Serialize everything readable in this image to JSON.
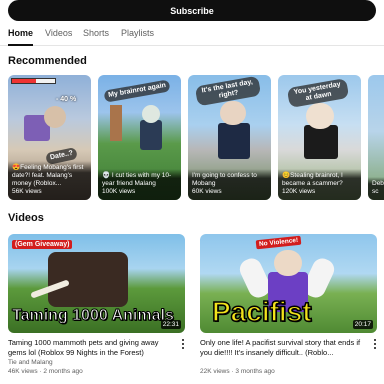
{
  "subscribe": {
    "label": "Subscribe"
  },
  "tabs": [
    {
      "label": "Home",
      "active": true
    },
    {
      "label": "Videos",
      "active": false
    },
    {
      "label": "Shorts",
      "active": false
    },
    {
      "label": "Playlists",
      "active": false
    }
  ],
  "recommended": {
    "title": "Recommended",
    "cards": [
      {
        "overlay": "Date..?",
        "hud": "- 40 %",
        "caption": "😍Feeling Mobang's first date?! feat. Malang's money (Roblox...",
        "meta": "56K views"
      },
      {
        "overlay": "My brainrot again",
        "caption": "💀 I cut ties with my 10-year friend Malang",
        "meta": "100K views"
      },
      {
        "overlay": "It's the last day, right?",
        "caption": "I'm going to confess to Mobang",
        "meta": "60K views"
      },
      {
        "overlay": "You yesterday at dawn",
        "caption": "😊Stealing brainrot, I became a scammer?",
        "meta": "120K views"
      },
      {
        "overlay": "",
        "caption": "Deb a sc",
        "meta": ""
      }
    ]
  },
  "videos": {
    "title": "Videos",
    "items": [
      {
        "thumb_badge": "(Gem Giveaway)",
        "thumb_text": "Taming 1000 Animals",
        "duration": "22:31",
        "title": "Taming 1000 mammoth pets and giving away gems lol (Roblox 99 Nights in the Forest)",
        "channel": "Tie and Malang",
        "meta": "46K views · 2 months ago"
      },
      {
        "thumb_badge": "No Violence!",
        "thumb_text": "Pacifist",
        "duration": "20:17",
        "title": "Only one life! A pacifist survival story that ends if you die!!!! It's insanely difficult.. (Roblo...",
        "channel": "",
        "meta": "22K views · 3 months ago"
      }
    ]
  },
  "colors": {
    "accent": "#0f0f0f",
    "secondary_text": "#606060",
    "gem_badge": "#d21d1d",
    "pacifist_text": "#f3e31b"
  }
}
